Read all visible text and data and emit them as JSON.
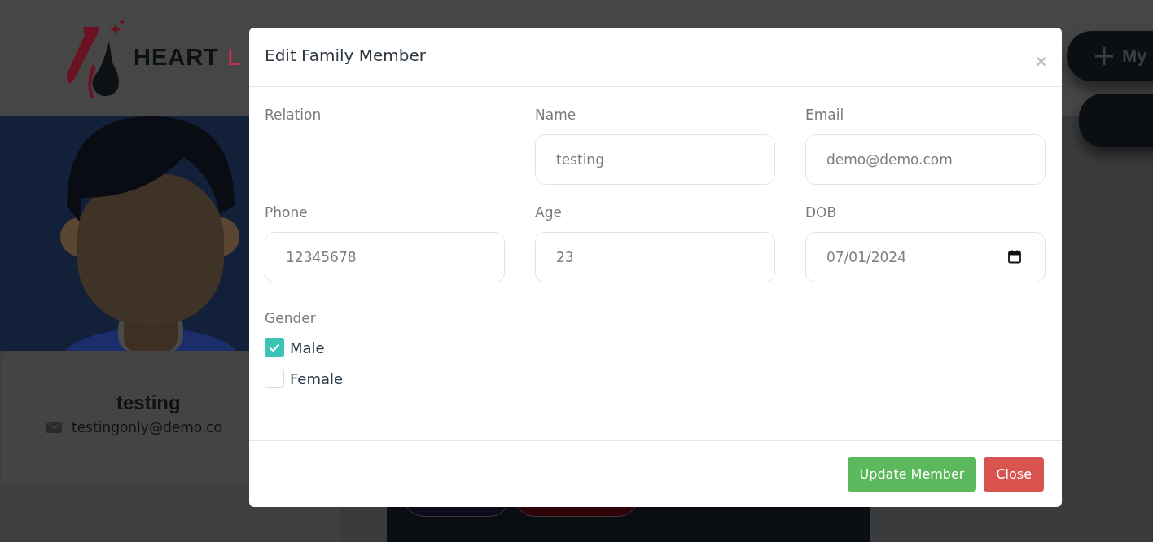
{
  "header": {
    "logo_bold": "HEART",
    "logo_light": "L",
    "my_button": "My"
  },
  "profile": {
    "name": "testing",
    "email": "testingonly@demo.co"
  },
  "modal": {
    "title": "Edit Family Member",
    "close_glyph": "×",
    "fields": [
      {
        "label": "Relation",
        "kind": "empty"
      },
      {
        "label": "Name",
        "kind": "text",
        "value": "testing"
      },
      {
        "label": "Email",
        "kind": "text",
        "value": "demo@demo.com"
      },
      {
        "label": "Phone",
        "kind": "text",
        "value": "12345678"
      },
      {
        "label": "Age",
        "kind": "text",
        "value": "23"
      },
      {
        "label": "DOB",
        "kind": "date",
        "value": "07/01/2024"
      }
    ],
    "gender": {
      "label": "Gender",
      "options": [
        {
          "label": "Male",
          "checked": true
        },
        {
          "label": "Female",
          "checked": false
        }
      ]
    },
    "buttons": [
      {
        "label": "Update Member",
        "kind": "primary"
      },
      {
        "label": "Close",
        "kind": "danger"
      }
    ]
  }
}
